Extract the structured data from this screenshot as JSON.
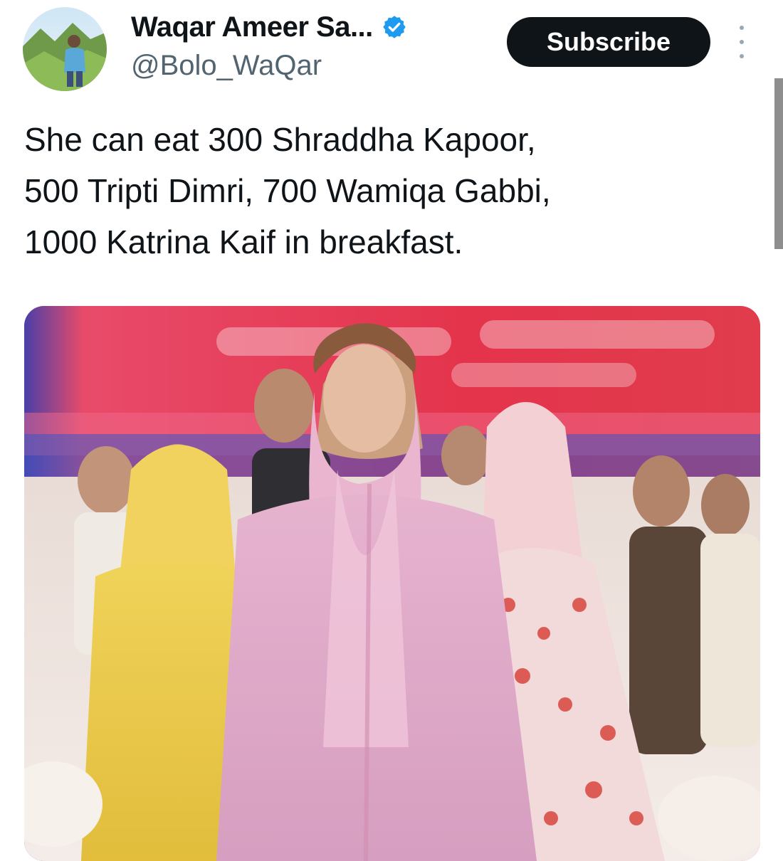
{
  "author": {
    "display_name": "Waqar Ameer Sa...",
    "handle": "@Bolo_WaQar",
    "avatar_icon": "profile-photo",
    "verified_icon": "verified-badge-icon",
    "verified_color": "#1d9bf0"
  },
  "actions": {
    "subscribe_label": "Subscribe",
    "more_icon": "more-vertical-icon"
  },
  "tweet": {
    "lines": [
      "She can eat 300 Shraddha Kapoor,",
      "500 Tripti Dimri, 700 Wamiqa Gabbi,",
      "1000 Katrina Kaif in breakfast."
    ]
  },
  "media": {
    "type": "photo"
  },
  "colors": {
    "text": "#0f1419",
    "secondary": "#536471",
    "button_bg": "#0f1419",
    "button_text": "#ffffff"
  }
}
